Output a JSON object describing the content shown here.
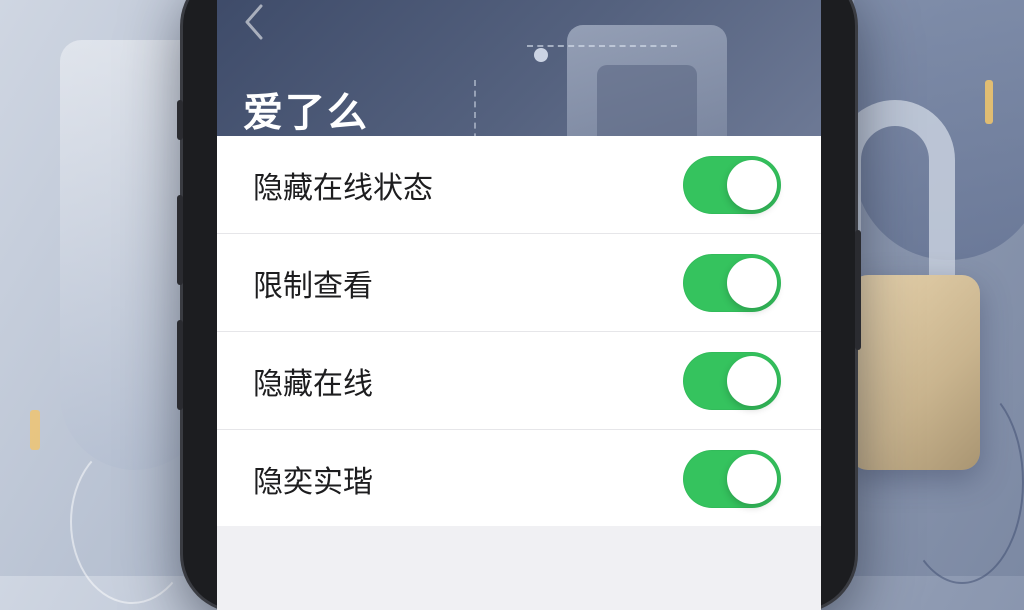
{
  "header": {
    "title": "爱了么",
    "back_icon": "chevron-left-icon"
  },
  "settings": {
    "items": [
      {
        "label": "隐藏在线状态",
        "enabled": true
      },
      {
        "label": "限制查看",
        "enabled": true
      },
      {
        "label": "隐藏在线",
        "enabled": true
      },
      {
        "label": "隐奕实瑎",
        "enabled": true
      }
    ]
  },
  "colors": {
    "toggle_on": "#35c35e",
    "header_bg": "#4a5775"
  }
}
